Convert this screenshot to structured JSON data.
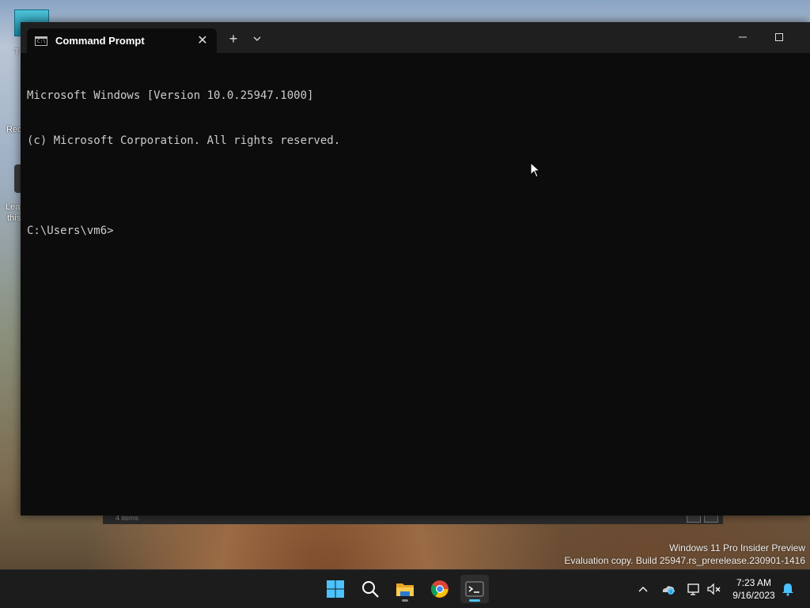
{
  "desktop": {
    "watermark_line1": "Windows 11 Pro Insider Preview",
    "watermark_line2": "Evaluation copy. Build 25947.rs_prerelease.230901-1416",
    "icon_label_1": "T",
    "icon_label_2": "Rec",
    "icon_label_3": "Lea",
    "icon_label_4": "this"
  },
  "window": {
    "tab_title": "Command Prompt",
    "tab_icon_text": "C:\\",
    "new_tab_label": "+",
    "close_tab_label": "✕"
  },
  "console": {
    "lines": [
      "Microsoft Windows [Version 10.0.25947.1000]",
      "(c) Microsoft Corporation. All rights reserved.",
      "",
      "C:\\Users\\vm6>"
    ]
  },
  "back_window": {
    "status_text": "4 items"
  },
  "taskbar": {
    "items": [
      "start-icon",
      "search-icon",
      "file-explorer-icon",
      "chrome-icon",
      "terminal-icon"
    ],
    "tray_icons": [
      "chevron-up-icon",
      "onedrive-icon",
      "network-icon",
      "volume-muted-icon",
      "notification-bell-icon"
    ],
    "time": "7:23 AM",
    "date": "9/16/2023"
  },
  "colors": {
    "terminal_bg": "#0c0c0c",
    "titlebar_bg": "#1f1f1f",
    "text": "#cccccc",
    "accent": "#4cc2ff"
  }
}
